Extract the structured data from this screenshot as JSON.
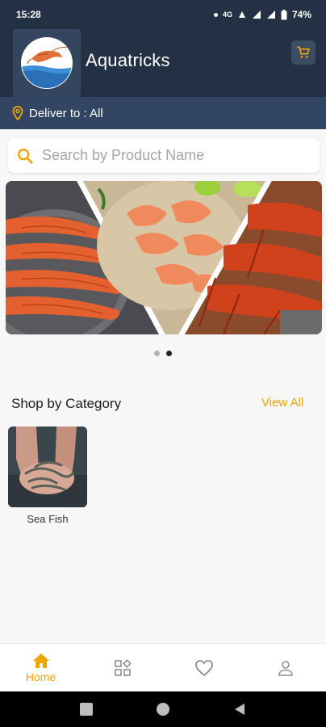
{
  "status_bar": {
    "time": "15:28",
    "network": "4G",
    "battery": "74%"
  },
  "header": {
    "app_title": "Aquatricks",
    "logo_icon": "shrimp-logo-icon",
    "cart_icon": "cart-icon"
  },
  "deliver": {
    "label": "Deliver to : All",
    "icon": "location-pin-icon"
  },
  "search": {
    "placeholder": "Search by Product Name",
    "icon": "search-icon"
  },
  "carousel": {
    "slide_count": 2,
    "active_index": 1
  },
  "category_section": {
    "title": "Shop by Category",
    "view_all": "View All",
    "items": [
      {
        "label": "Sea Fish"
      }
    ]
  },
  "bottom_nav": {
    "items": [
      {
        "label": "Home",
        "icon": "home-icon",
        "active": true
      },
      {
        "label": "",
        "icon": "categories-icon",
        "active": false
      },
      {
        "label": "",
        "icon": "heart-icon",
        "active": false
      },
      {
        "label": "",
        "icon": "profile-icon",
        "active": false
      }
    ]
  },
  "colors": {
    "header_bg": "#243144",
    "deliver_bg": "#324663",
    "accent": "#F0A400"
  }
}
